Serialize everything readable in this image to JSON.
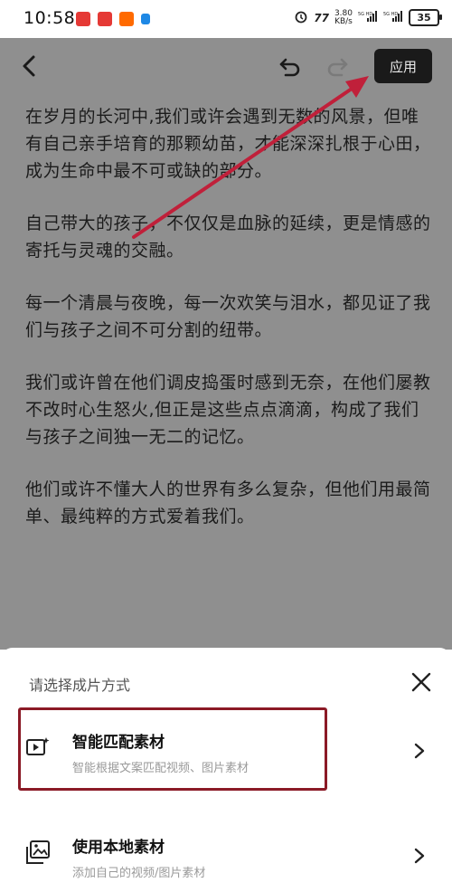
{
  "status_bar": {
    "time": "10:58",
    "speed": "3.80",
    "speed_unit": "KB/s",
    "battery": "35"
  },
  "editor": {
    "apply_label": "应用",
    "paragraphs": [
      "在岁月的长河中,我们或许会遇到无数的风景，但唯有自己亲手培育的那颗幼苗，才能深深扎根于心田，成为生命中最不可或缺的部分。",
      "自己带大的孩子，不仅仅是血脉的延续，更是情感的寄托与灵魂的交融。",
      "每一个清晨与夜晚，每一次欢笑与泪水，都见证了我们与孩子之间不可分割的纽带。",
      "我们或许曾在他们调皮捣蛋时感到无奈，在他们屡教不改时心生怒火,但正是这些点点滴滴，构成了我们与孩子之间独一无二的记忆。",
      "他们或许不懂大人的世界有多么复杂，但他们用最简单、最纯粹的方式爱着我们。"
    ]
  },
  "sheet": {
    "title": "请选择成片方式",
    "options": [
      {
        "title": "智能匹配素材",
        "subtitle": "智能根据文案匹配视频、图片素材",
        "icon": "smart-video-icon"
      },
      {
        "title": "使用本地素材",
        "subtitle": "添加自己的视频/图片素材",
        "icon": "gallery-icon"
      }
    ]
  },
  "colors": {
    "annotation": "#c0203a",
    "highlight_box": "#8b1a26",
    "dim_overlay": "#8f8f8f"
  }
}
